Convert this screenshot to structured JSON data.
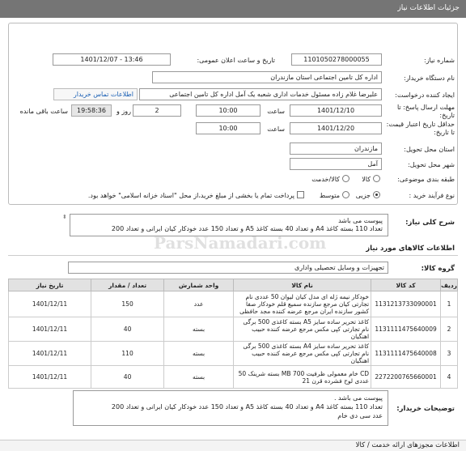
{
  "header": {
    "title": "جزئیات اطلاعات نیاز"
  },
  "form": {
    "need_number_label": "شماره نیاز:",
    "need_number": "1101050278000055",
    "announce_label": "تاریخ و ساعت اعلان عمومی:",
    "announce_value": "1401/12/07 - 13:46",
    "buyer_label": "نام دستگاه خریدار:",
    "buyer_value": "اداره کل تامین اجتماعی استان مازندران",
    "creator_label": "ایجاد کننده درخواست:",
    "creator_value": "علیرضا غلام زاده مسئول خدمات اداری شعبه یک آمل اداره کل تامین اجتماعی",
    "contact_link": "اطلاعات تماس خریدار",
    "deadline_label": "مهلت ارسال پاسخ: تا تاریخ:",
    "deadline_date": "1401/12/10",
    "time_label": "ساعت",
    "deadline_time": "10:00",
    "days_value": "2",
    "days_label": "روز و",
    "remaining_time": "19:58:36",
    "remaining_label": "ساعت باقی مانده",
    "validity_label": "حداقل تاریخ اعتبار قیمت: تا تاریخ:",
    "validity_date": "1401/12/20",
    "validity_time": "10:00",
    "province_label": "استان محل تحویل:",
    "province_value": "مازندران",
    "city_label": "شهر محل تحویل:",
    "city_value": "آمل",
    "category_label": "طبقه بندی موضوعی:",
    "category_options": [
      "کالا",
      "کالا/خدمت"
    ],
    "process_label": "نوع فرآیند خرید :",
    "process_options": [
      "جزیی",
      "متوسط"
    ],
    "payment_note": "پرداخت تمام یا بخشی از مبلغ خرید،از محل \"اسناد خزانه اسلامی\" خواهد بود."
  },
  "need_summary": {
    "label": "شرح کلی نیاز:",
    "line1": "پیوست می باشد",
    "line2": "تعداد 110 بسته کاغذ A4 و تعداد 40 بسته کاغذ A5   و تعداد 150 عدد خودکار کیان ایرانی و تعداد 200"
  },
  "goods_section_title": "اطلاعات کالاهای مورد نیاز",
  "goods_group": {
    "label": "گروه کالا:",
    "value": "تجهیزات و وسایل تحصیلی واداری"
  },
  "table": {
    "headers": [
      "ردیف",
      "کد کالا",
      "نام کالا",
      "واحد شمارش",
      "تعداد / مقدار",
      "تاریخ نیاز"
    ],
    "rows": [
      {
        "idx": "1",
        "code": "1131213733090001",
        "name": "خودکار نیمه ژله ای مدل کیان لیوان 50 عددی نام تجارتی کیان مرجع سازنده سمیع قلم خودکار صفا کشور سازنده ایران مرجع عرضه کننده مجد حافظی",
        "unit": "عدد",
        "qty": "150",
        "date": "1401/12/11"
      },
      {
        "idx": "2",
        "code": "1131111475640009",
        "name": "کاغذ تحریر ساده سایز A5 بسته کاغذی 500 برگی نام تجارتی کپی مکس مرجع عرضه کننده حبیب اهنگیان",
        "unit": "بسته",
        "qty": "40",
        "date": "1401/12/11"
      },
      {
        "idx": "3",
        "code": "1131111475640008",
        "name": "کاغذ تحریر ساده سایز A4 بسته کاغذی 500 برگی نام تجارتی کپی مکس مرجع عرضه کننده حبیب اهنگیان",
        "unit": "بسته",
        "qty": "110",
        "date": "1401/12/11"
      },
      {
        "idx": "4",
        "code": "2272200765660001",
        "name": "CD خام معمولی ظرفیت 700 MB بسته شرینک 50 عددی لوح فشرده قرن 21",
        "unit": "بسته",
        "qty": "40",
        "date": "1401/12/11"
      }
    ]
  },
  "buyer_notes": {
    "label": "توضیحات خریدار:",
    "line1": "پیوست می باشد .",
    "line2": "تعداد 110 بسته کاغذ A4 و تعداد 40 بسته کاغذ A5   و تعداد 150 عدد خودکار کیان ایرانی و تعداد 200",
    "line3": "عدد سی دی خام"
  },
  "watermark": "ParsNamadari.com",
  "footer": {
    "text": "اطلاعات مجوزهای ارائه خدمت / کالا"
  }
}
